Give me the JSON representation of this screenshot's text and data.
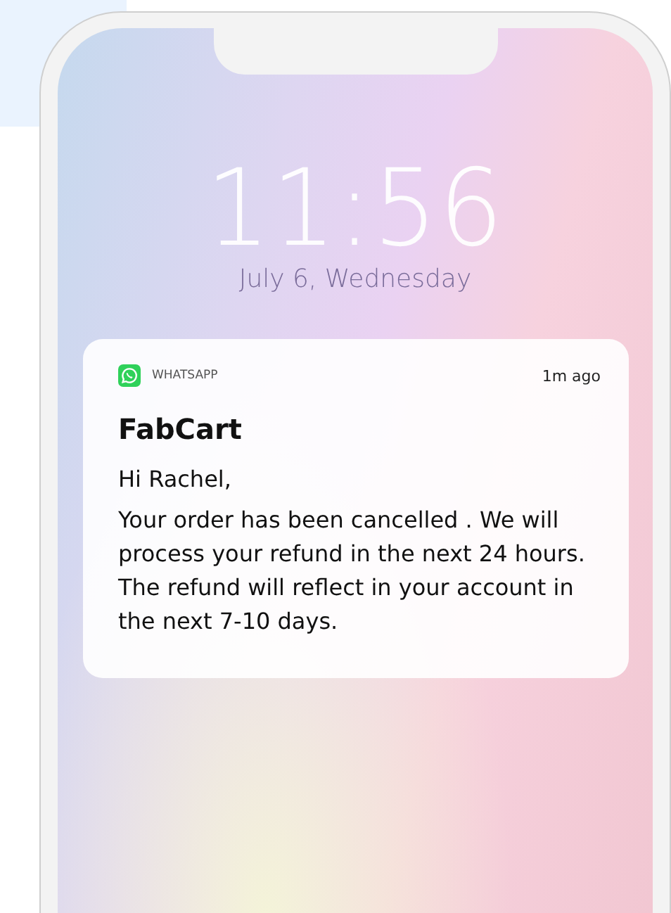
{
  "lock_screen": {
    "time": "11:56",
    "date": "July 6, Wednesday"
  },
  "notification": {
    "app": "WHATSAPP",
    "age": "1m ago",
    "title": "FabCart",
    "greeting": "Hi Rachel,",
    "message": "Your order has been cancelled . We will process your refund in the next 24 hours. The refund will reflect in your account in the next 7-10 days."
  }
}
